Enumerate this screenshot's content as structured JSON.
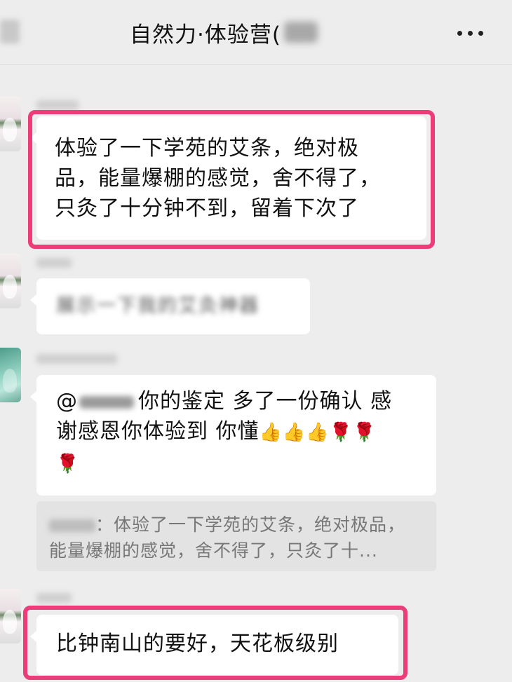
{
  "header": {
    "title": "自然力·体验营(",
    "more_icon": "more-dots-icon"
  },
  "messages": [
    {
      "id": "msg1",
      "text": "体验了一下学苑的艾条，绝对极品，能量爆棚的感觉，舍不得了，只灸了十分钟不到，留着下次了",
      "lines": [
        "体验了一下学苑的艾条，绝对极",
        "品，能量爆棚的感觉，舍不得了，",
        "只灸了十分钟不到，留着下次了"
      ],
      "highlighted": true
    },
    {
      "id": "msg2",
      "text": "展示一下我的艾灸神器"
    },
    {
      "id": "msg3",
      "prefix": "@",
      "line1_rest": "你的鉴定 多了一份确认 感",
      "line2": "谢感恩你体验到 你懂",
      "emojis_line2": "👍👍👍🌹🌹",
      "emojis_line3": "🌹",
      "quote": {
        "separator": "：",
        "line1": "体验了一下学苑的艾条，绝对极品，",
        "line2": "能量爆棚的感觉，舍不得了，只灸了十..."
      }
    },
    {
      "id": "msg4",
      "text": "比钟南山的要好，天花板级别",
      "highlighted": true
    }
  ],
  "colors": {
    "background": "#ededed",
    "bubble": "#ffffff",
    "highlight": "#ec3d7a",
    "quote_bg": "#e3e3e3"
  }
}
